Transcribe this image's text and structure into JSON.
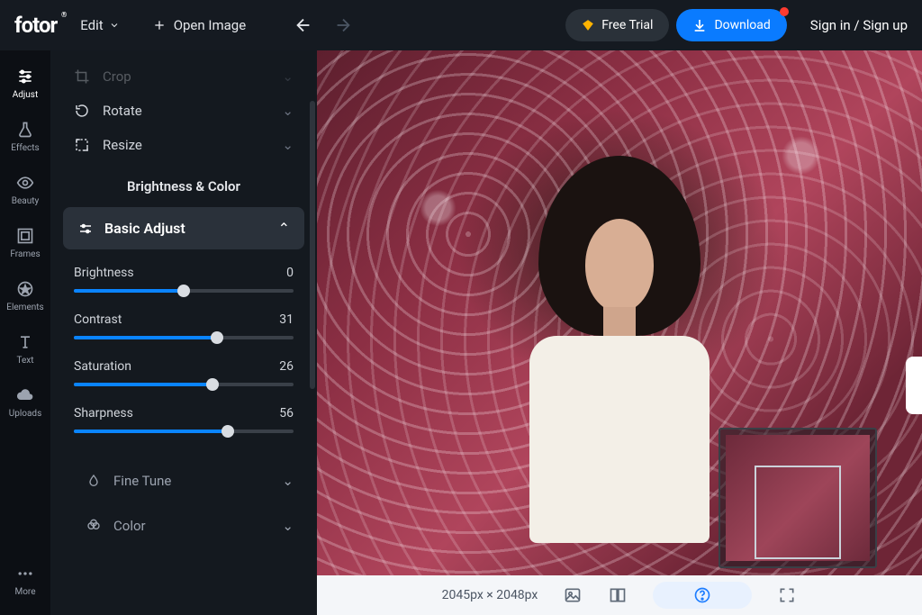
{
  "header": {
    "logo": "fotor",
    "edit": "Edit",
    "openImage": "Open Image",
    "freeTrial": "Free Trial",
    "download": "Download",
    "auth": "Sign in / Sign up"
  },
  "rail": {
    "items": [
      {
        "icon": "sliders-icon",
        "label": "Adjust",
        "active": true
      },
      {
        "icon": "flask-icon",
        "label": "Effects"
      },
      {
        "icon": "eye-icon",
        "label": "Beauty"
      },
      {
        "icon": "frame-icon",
        "label": "Frames"
      },
      {
        "icon": "star-icon",
        "label": "Elements"
      },
      {
        "icon": "text-icon",
        "label": "Text"
      },
      {
        "icon": "cloud-icon",
        "label": "Uploads"
      }
    ],
    "more": "More"
  },
  "panel": {
    "tools": [
      {
        "icon": "crop-icon",
        "label": "Crop"
      },
      {
        "icon": "rotate-icon",
        "label": "Rotate"
      },
      {
        "icon": "resize-icon",
        "label": "Resize"
      }
    ],
    "sectionTitle": "Brightness & Color",
    "accordion": {
      "icon": "tune-icon",
      "label": "Basic Adjust"
    },
    "sliders": [
      {
        "label": "Brightness",
        "value": 0,
        "min": -100,
        "max": 100,
        "pct": 50
      },
      {
        "label": "Contrast",
        "value": 31,
        "min": -100,
        "max": 100,
        "pct": 65
      },
      {
        "label": "Saturation",
        "value": 26,
        "min": -100,
        "max": 100,
        "pct": 63
      },
      {
        "label": "Sharpness",
        "value": 56,
        "min": 0,
        "max": 100,
        "pct": 70
      }
    ],
    "subs": [
      {
        "icon": "drop-icon",
        "label": "Fine Tune"
      },
      {
        "icon": "palette-icon",
        "label": "Color"
      }
    ]
  },
  "bottom": {
    "dim": "2045px × 2048px"
  }
}
